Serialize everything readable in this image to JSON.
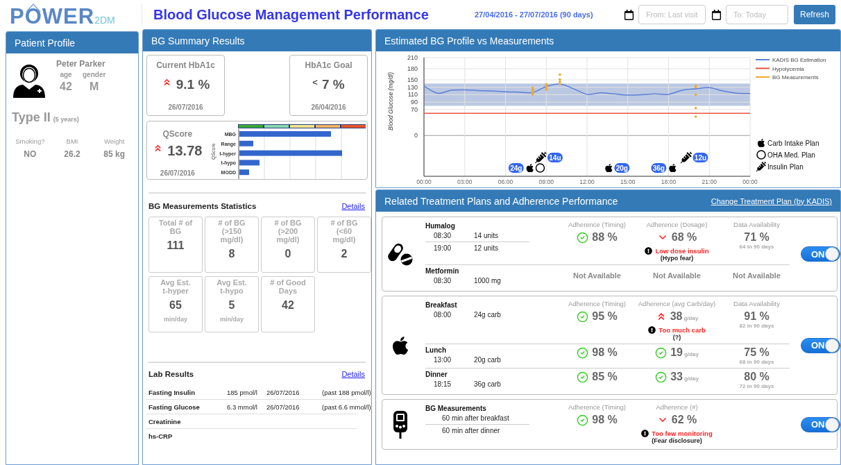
{
  "header": {
    "logo": {
      "main": "POWER",
      "suffix": "2DM"
    },
    "title": "Blood Glucose Management Performance",
    "date_range": "27/04/2016 - 27/07/2016 (90 days)",
    "from_field": {
      "placeholder": "From: Last visit"
    },
    "to_field": {
      "placeholder": "To: Today"
    },
    "refresh_button": "Refresh"
  },
  "patient_profile": {
    "title": "Patient Profile",
    "name": "Peter Parker",
    "fields": [
      {
        "label": "age",
        "value": "42"
      },
      {
        "label": "gender",
        "value": "M"
      }
    ],
    "diabetes_type": "Type II",
    "duration": "(5 years)",
    "stats": [
      {
        "label": "Smoking?",
        "value": "NO"
      },
      {
        "label": "BMI",
        "value": "26.2"
      },
      {
        "label": "Weight",
        "value": "85 kg"
      }
    ]
  },
  "bg_summary": {
    "title": "BG Summary Results",
    "hba1c_current": {
      "label": "Current HbA1c",
      "trend_up": true,
      "value": "9.1 %",
      "date": "26/07/2016"
    },
    "hba1c_goal": {
      "label": "HbA1c Goal",
      "prefix": "<",
      "value": "7 %",
      "date": "26/04/2016"
    },
    "qscore": {
      "label": "QScore",
      "trend_up": true,
      "value": "13.78",
      "date": "26/07/2016",
      "chart": {
        "axis_label": "QScore",
        "categories": [
          "MBG",
          "Range",
          "t-hyper",
          "t-hypo",
          "MODD"
        ]
      }
    },
    "statistics": {
      "title": "BG Measurements Statistics",
      "details_link": "Details",
      "tiles": [
        {
          "label": "Total # of BG",
          "value": "111"
        },
        {
          "label": "# of BG (>150 mg/dl)",
          "value": "8"
        },
        {
          "label": "# of BG (>200 mg/dl)",
          "value": "0"
        },
        {
          "label": "# of BG (<60 mg/dl)",
          "value": "2"
        },
        {
          "label": "Avg Est. t-hyper",
          "value": "65",
          "unit": "min/day"
        },
        {
          "label": "Avg Est. t-hypo",
          "value": "5",
          "unit": "min/day"
        },
        {
          "label": "# of Good Days",
          "value": "42"
        }
      ]
    },
    "lab_results": {
      "title": "Lab Results",
      "details_link": "Details",
      "rows": [
        {
          "name": "Fasting Insulin",
          "value": "185 pmol/l",
          "date": "26/07/2016",
          "past": "(past 188 pmol/l)"
        },
        {
          "name": "Fasting Glucose",
          "value": "6.3 mmol/l",
          "date": "26/07/2016",
          "past": "(past 6.6 mmol/l)"
        },
        {
          "name": "Creatinine"
        },
        {
          "name": "hs-CRP"
        }
      ]
    }
  },
  "bg_profile": {
    "title": "Estimated BG Profile vs Measurements",
    "chart_data": {
      "type": "line",
      "ylabel": "Blood Glucose (mg/dl)",
      "xlim": [
        0,
        24
      ],
      "ylim": [
        -110,
        210
      ],
      "grid": true,
      "legend": true,
      "bands": [
        {
          "axis": "y",
          "from": 80,
          "to": 140
        }
      ],
      "x": [
        0,
        1,
        2,
        3,
        4,
        5,
        6,
        7,
        8,
        9,
        10,
        11,
        12,
        13,
        14,
        15,
        16,
        17,
        18,
        19,
        20,
        21,
        22,
        23,
        24
      ],
      "xticks": [
        {
          "value": 0,
          "label": "00:00"
        },
        {
          "value": 3,
          "label": "03:00"
        },
        {
          "value": 6,
          "label": "06:00"
        },
        {
          "value": 9,
          "label": "09:00"
        },
        {
          "value": 12,
          "label": "12:00"
        },
        {
          "value": 15,
          "label": "15:00"
        },
        {
          "value": 18,
          "label": "18:00"
        },
        {
          "value": 21,
          "label": "21:00"
        },
        {
          "value": 24,
          "label": "00:00"
        }
      ],
      "yticks": [
        {
          "value": 0,
          "label": "0"
        },
        {
          "value": 70,
          "label": "70"
        },
        {
          "value": 90,
          "label": "90"
        },
        {
          "value": 110,
          "label": "110"
        },
        {
          "value": 130,
          "label": "130"
        },
        {
          "value": 150,
          "label": "150"
        },
        {
          "value": 180,
          "label": "180"
        },
        {
          "value": 210,
          "label": "210"
        }
      ],
      "series": [
        {
          "name": "KADIS BG Estimation",
          "color": "#5a7fd8",
          "values": [
            133,
            114,
            122,
            123,
            121,
            120,
            118,
            117,
            116,
            132,
            139,
            126,
            111,
            115,
            112,
            109,
            110,
            112,
            111,
            122,
            126,
            129,
            120,
            114,
            113
          ]
        },
        {
          "name": "Hypolycemia",
          "color": "#e8553c",
          "values": [
            60,
            60,
            60,
            60,
            60,
            60,
            60,
            60,
            60,
            60,
            60,
            60,
            60,
            60,
            60,
            60,
            60,
            60,
            60,
            60,
            60,
            60,
            60,
            60,
            60
          ]
        }
      ]
    },
    "measurement_legend": {
      "label": "BG Measurements",
      "color": "#f0a830"
    },
    "plan_events": [
      {
        "kind": "carb",
        "label": "24g"
      },
      {
        "kind": "oha"
      },
      {
        "kind": "insulin",
        "label": "14u"
      },
      {
        "kind": "carb",
        "label": "20g"
      },
      {
        "kind": "carb",
        "label": "36g"
      },
      {
        "kind": "insulin",
        "label": "12u"
      }
    ],
    "plan_legend": [
      {
        "kind": "carb",
        "label": "Carb Intake Plan"
      },
      {
        "kind": "oha",
        "label": "OHA Med. Plan"
      },
      {
        "kind": "insulin",
        "label": "Insulin Plan"
      }
    ]
  },
  "treatment": {
    "title": "Related Treatment Plans and Adherence Performance",
    "change_link": "Change Treatment Plan (by KADIS)",
    "plans": [
      {
        "kind": "medication",
        "headers": [
          "Adherence (Timing)",
          "Adherence (Dosage)",
          "Data Availability"
        ],
        "toggle": {
          "label": "ON",
          "on": true
        },
        "groups": [
          {
            "name": "Humalog",
            "entries": [
              {
                "time": "08:30",
                "amount": "14 units"
              },
              {
                "time": "19:00",
                "amount": "12 units"
              }
            ],
            "metrics": [
              {
                "kind": "check",
                "value": "88 %"
              },
              {
                "kind": "down",
                "value": "68 %",
                "warning": "Low dose insulin",
                "note": "(Hypo fear)"
              },
              {
                "kind": "plain",
                "value": "71 %",
                "sub": "64 in 90 days"
              }
            ]
          },
          {
            "name": "Metformin",
            "entries": [
              {
                "time": "08:30",
                "amount": "1000 mg"
              }
            ],
            "metrics": [
              {
                "kind": "na",
                "value": "Not Available"
              },
              {
                "kind": "na",
                "value": "Not Available"
              },
              {
                "kind": "na",
                "value": "Not Available"
              }
            ]
          }
        ]
      },
      {
        "kind": "carb",
        "headers": [
          "Adherence (Timing)",
          "Adherence (avg Carb/day)",
          "Data Availability"
        ],
        "toggle": {
          "label": "ON",
          "on": true
        },
        "groups": [
          {
            "name": "Breakfast",
            "entries": [
              {
                "time": "08:00",
                "amount": "24g carb"
              }
            ],
            "metrics": [
              {
                "kind": "check",
                "value": "95 %"
              },
              {
                "kind": "up",
                "value": "38",
                "unit": "g/day",
                "warning": "Too much carb",
                "note": "(?)"
              },
              {
                "kind": "plain",
                "value": "91 %",
                "sub": "82 in 90 days"
              }
            ]
          },
          {
            "name": "Lunch",
            "entries": [
              {
                "time": "13:00",
                "amount": "20g carb"
              }
            ],
            "metrics": [
              {
                "kind": "check",
                "value": "98 %"
              },
              {
                "kind": "check",
                "value": "19",
                "unit": "g/day"
              },
              {
                "kind": "plain",
                "value": "75 %",
                "sub": "68 in 90 days"
              }
            ]
          },
          {
            "name": "Dinner",
            "entries": [
              {
                "time": "18:15",
                "amount": "36g carb"
              }
            ],
            "metrics": [
              {
                "kind": "check",
                "value": "85 %"
              },
              {
                "kind": "check",
                "value": "33",
                "unit": "g/day"
              },
              {
                "kind": "plain",
                "value": "80 %",
                "sub": "72 in 90 days"
              }
            ]
          }
        ]
      },
      {
        "kind": "measurement",
        "headers": [
          "Adherence (Timing)",
          "Adherence (#)"
        ],
        "toggle": {
          "label": "ON",
          "on": true
        },
        "groups": [
          {
            "name": "BG Measurements",
            "entries": [
              {
                "time": "60 min after breakfast"
              },
              {
                "time": "60 min after dinner"
              }
            ],
            "metrics": [
              {
                "kind": "check",
                "value": "98 %"
              },
              {
                "kind": "down",
                "value": "62 %",
                "warning": "Too few monitoring",
                "note": "(Fear disclosure)"
              }
            ]
          }
        ]
      }
    ]
  }
}
